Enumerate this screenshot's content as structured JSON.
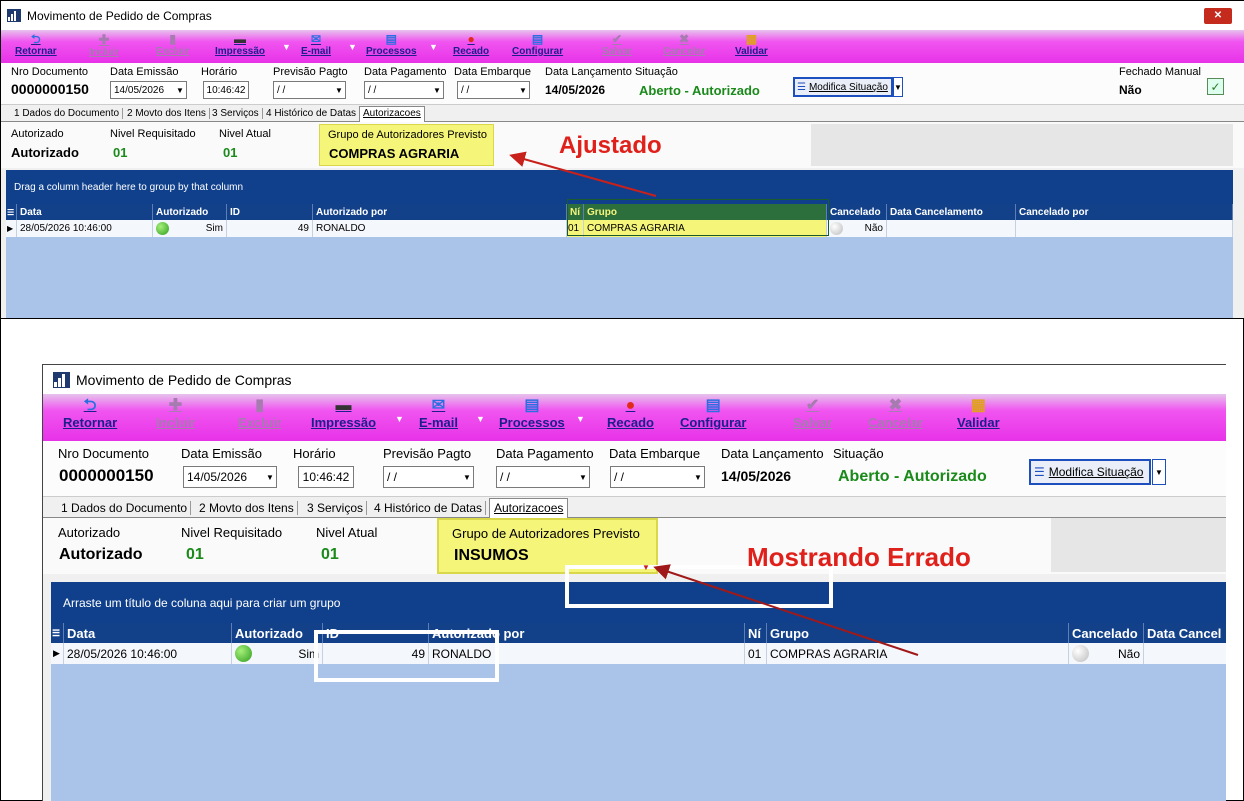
{
  "top": {
    "title": "Movimento de Pedido de Compras",
    "close_label": "✕",
    "toolbar": {
      "retornar": "Retornar",
      "incluir": "Incluir",
      "excluir": "Excluir",
      "impressao": "Impressão",
      "email": "E-mail",
      "processos": "Processos",
      "recado": "Recado",
      "configurar": "Configurar",
      "salvar": "Salvar",
      "cancelar": "Cancelar",
      "validar": "Validar",
      "dropdown_glyph": "▼"
    },
    "fields": {
      "nro_documento_label": "Nro Documento",
      "nro_documento": "0000000150",
      "data_emissao_label": "Data Emissão",
      "data_emissao": "14/05/2026",
      "horario_label": "Horário",
      "horario": "10:46:42",
      "previsao_pagto_label": "Previsão Pagto",
      "previsao_pagto": "/ /",
      "data_pagamento_label": "Data Pagamento",
      "data_pagamento": "/ /",
      "data_embarque_label": "Data Embarque",
      "data_embarque": "/ /",
      "data_lancamento_label": "Data Lançamento",
      "data_lancamento": "14/05/2026",
      "situacao_label": "Situação",
      "situacao": "Aberto - Autorizado",
      "modifica_situacao": "Modifica Situação",
      "fechado_manual_label": "Fechado Manual",
      "fechado_manual": "Não"
    },
    "tabs": [
      "1 Dados do Documento",
      "2 Movto dos Itens",
      "3 Serviços",
      "4 Histórico de Datas",
      "Autorizacoes"
    ],
    "auth": {
      "autorizado_label": "Autorizado",
      "autorizado": "Autorizado",
      "nivel_requisitado_label": "Nivel Requisitado",
      "nivel_requisitado": "01",
      "nivel_atual_label": "Nivel Atual",
      "nivel_atual": "01",
      "grupo_label": "Grupo de Autorizadores Previsto",
      "grupo": "COMPRAS AGRARIA"
    },
    "annotation": "Ajustado",
    "grid": {
      "drag_hint": "Drag a column header here to group by that column",
      "columns": [
        "Data",
        "Autorizado",
        "ID",
        "Autorizado por",
        "Ní",
        "Grupo",
        "Cancelado",
        "Data Cancelamento",
        "Cancelado por"
      ],
      "rows": [
        {
          "data": "28/05/2026 10:46:00",
          "autorizado": "Sim",
          "id": "49",
          "autorizado_por": "RONALDO",
          "ni": "01",
          "grupo": "COMPRAS AGRARIA",
          "cancelado": "Não",
          "data_cancelamento": "",
          "cancelado_por": ""
        }
      ]
    }
  },
  "bottom": {
    "title": "Movimento de Pedido de Compras",
    "toolbar": {
      "retornar": "Retornar",
      "incluir": "Incluir",
      "excluir": "Excluir",
      "impressao": "Impressão",
      "email": "E-mail",
      "processos": "Processos",
      "recado": "Recado",
      "configurar": "Configurar",
      "salvar": "Salvar",
      "cancelar": "Cancelar",
      "validar": "Validar",
      "dropdown_glyph": "▼"
    },
    "fields": {
      "nro_documento_label": "Nro Documento",
      "nro_documento": "0000000150",
      "data_emissao_label": "Data Emissão",
      "data_emissao": "14/05/2026",
      "horario_label": "Horário",
      "horario": "10:46:42",
      "previsao_pagto_label": "Previsão Pagto",
      "previsao_pagto": "/ /",
      "data_pagamento_label": "Data Pagamento",
      "data_pagamento": "/ /",
      "data_embarque_label": "Data Embarque",
      "data_embarque": "/ /",
      "data_lancamento_label": "Data Lançamento",
      "data_lancamento": "14/05/2026",
      "situacao_label": "Situação",
      "situacao": "Aberto - Autorizado",
      "modifica_situacao": "Modifica Situação"
    },
    "tabs": [
      "1 Dados do Documento",
      "2 Movto dos Itens",
      "3 Serviços",
      "4 Histórico de Datas",
      "Autorizacoes"
    ],
    "auth": {
      "autorizado_label": "Autorizado",
      "autorizado": "Autorizado",
      "nivel_requisitado_label": "Nivel Requisitado",
      "nivel_requisitado": "01",
      "nivel_atual_label": "Nivel Atual",
      "nivel_atual": "01",
      "grupo_label": "Grupo de Autorizadores Previsto",
      "grupo": "INSUMOS"
    },
    "annotation": "Mostrando Errado",
    "grid": {
      "drag_hint": "Arraste um título de coluna aqui para criar um grupo",
      "columns": [
        "Data",
        "Autorizado",
        "ID",
        "Autorizado por",
        "Ní",
        "Grupo",
        "Cancelado",
        "Data Cancel"
      ],
      "rows": [
        {
          "data": "28/05/2026 10:46:00",
          "autorizado": "Sim",
          "id": "49",
          "autorizado_por": "RONALDO",
          "ni": "01",
          "grupo": "COMPRAS AGRARIA",
          "cancelado": "Não",
          "data_cancelamento": ""
        }
      ]
    }
  },
  "colors": {
    "toolbar": "#e832e8",
    "grid_header": "#12418a",
    "grid_bg": "#a9c4e8",
    "annotation": "#e0201a",
    "situacao": "#1a8a1a",
    "group_highlight": "#f5f57a"
  }
}
